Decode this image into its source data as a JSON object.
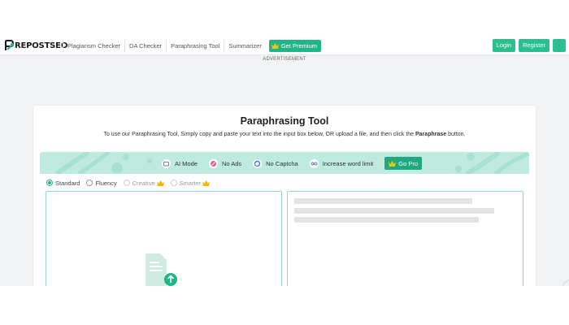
{
  "header": {
    "logo": "REPOSTSEO",
    "nav": [
      "Plagiarism Checker",
      "DA Checker",
      "Paraphrasing Tool",
      "Summarizer"
    ],
    "premium_label": "Get Premium",
    "login_label": "Login",
    "register_label": "Register"
  },
  "ad_label": "ADVERTISEMENT",
  "tool": {
    "title": "Paraphrasing Tool",
    "subtitle_before": "To use our Paraphrasing Tool, Simply copy and paste your text into the input box below, OR upload a file, and then click the ",
    "subtitle_bold": "Paraphrase",
    "subtitle_after": " button."
  },
  "features": {
    "items": [
      {
        "label": "AI Mode",
        "icon": "ai-mode-icon"
      },
      {
        "label": "No Ads",
        "icon": "no-ads-icon"
      },
      {
        "label": "No Captcha",
        "icon": "captcha-icon"
      },
      {
        "label": "Increase word limit",
        "icon": "infinity-icon"
      }
    ],
    "go_pro_label": "Go Pro"
  },
  "modes": [
    {
      "label": "Standard",
      "selected": true,
      "premium": false
    },
    {
      "label": "Fluency",
      "selected": false,
      "premium": false
    },
    {
      "label": "Creative",
      "selected": false,
      "premium": true
    },
    {
      "label": "Smarter",
      "selected": false,
      "premium": true
    }
  ],
  "colors": {
    "accent": "#20b589",
    "banner": "#bfeadf",
    "border": "#8fd8c2",
    "premium": "#f5b400"
  }
}
